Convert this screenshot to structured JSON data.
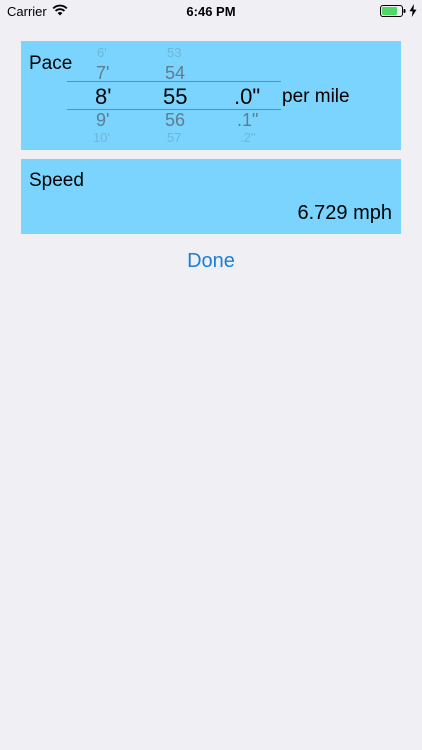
{
  "status_bar": {
    "carrier": "Carrier",
    "time": "6:46 PM"
  },
  "pace": {
    "label": "Pace",
    "unit_label": "per mile",
    "minutes": {
      "faint_above": "6'",
      "above": "7'",
      "selected": "8'",
      "below": "9'",
      "faint_below": "10'"
    },
    "seconds": {
      "faint_above": "53",
      "above": "54",
      "selected": "55",
      "below": "56",
      "faint_below": "57"
    },
    "tenths": {
      "selected": ".0\"",
      "below": ".1\"",
      "faint_below": ".2\""
    }
  },
  "speed": {
    "label": "Speed",
    "value": "6.729 mph"
  },
  "done_label": "Done",
  "colors": {
    "panel": "#7ad4fd",
    "background": "#efeff4",
    "accent": "#1a7fd8"
  }
}
